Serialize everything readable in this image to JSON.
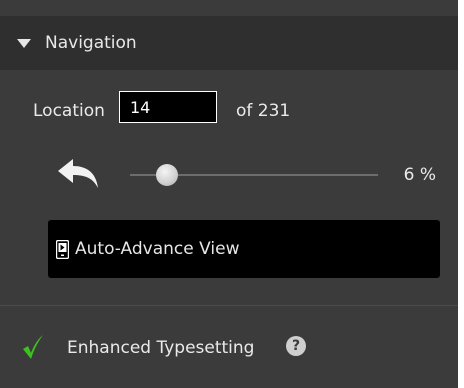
{
  "navigation": {
    "title": "Navigation",
    "expanded_icon": "triangle-down-icon"
  },
  "location": {
    "label": "Location",
    "value": "14",
    "of_label": "of 231",
    "total": 231
  },
  "slider": {
    "back_icon": "back-arrow-icon",
    "value_label": "6 %",
    "value": 0.06
  },
  "auto_advance": {
    "icon": "auto-advance-icon",
    "label": "Auto-Advance View"
  },
  "enhanced_typesetting": {
    "icon": "checkmark-icon",
    "label": "Enhanced Typesetting",
    "help_icon": "question-icon",
    "help_text": "?",
    "check_color": "#3cc21e"
  },
  "colors": {
    "panel": "#3b3b3b",
    "header": "#2f2f2f",
    "input_background": "#000000",
    "text": "#eaeaea"
  }
}
